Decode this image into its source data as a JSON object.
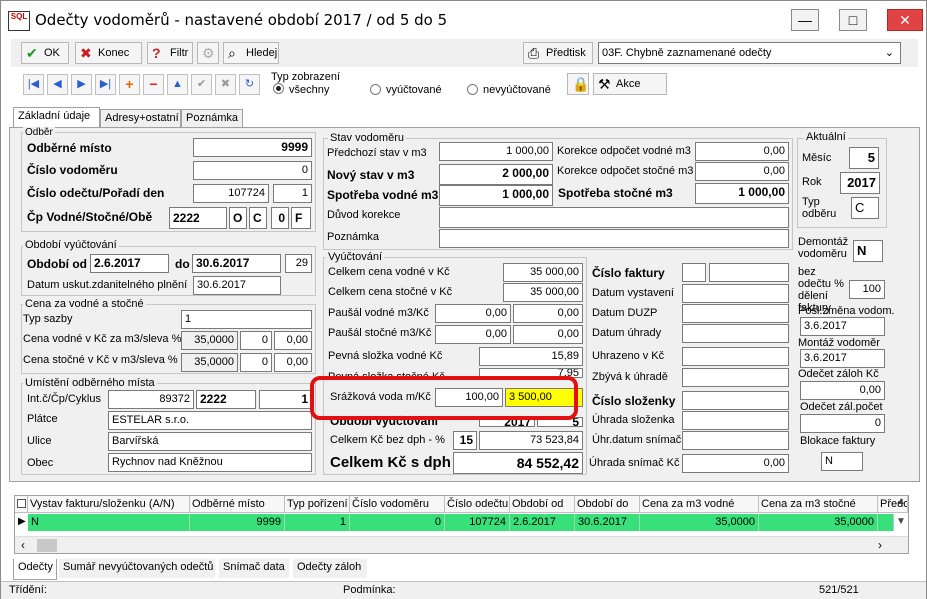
{
  "window": {
    "title": "Odečty vodoměrů - nastavené období 2017 / od 5 do 5",
    "logo": "SQL"
  },
  "toolbar1": {
    "ok": "OK",
    "konec": "Konec",
    "filtr": "Filtr",
    "hledej": "Hledej",
    "predtisk": "Předtisk",
    "report": "03F. Chybně zaznamenané odečty"
  },
  "toolbar2": {
    "view_label": "Typ zobrazení",
    "r_all": "všechny",
    "r_billed": "vyúčtované",
    "r_unbilled": "nevyúčtované",
    "akce": "Akce"
  },
  "tabs": [
    "Základní údaje",
    "Adresy+ostatní",
    "Poznámka"
  ],
  "left": {
    "odberatel": "Odběr",
    "odberne_misto_lbl": "Odběrné místo",
    "odberne_misto": "9999",
    "cislo_vodomeru_lbl": "Číslo vodoměru",
    "cislo_vodomeru": "0",
    "cislo_odectu_lbl": "Číslo odečtu/Pořadí den",
    "cislo_odectu": "107724",
    "poradi": "1",
    "cp_lbl": "Čp  Vodné/Stočné/Obě",
    "cp": "2222",
    "o": "O",
    "c": "C",
    "zero": "0",
    "f": "F",
    "obdobi_grp": "Období vyúčtování",
    "obdobi_od_lbl": "Období od",
    "obdobi_od": "2.6.2017",
    "do_lbl": "do",
    "obdobi_do": "30.6.2017",
    "dni": "29",
    "datum_uskut_lbl": "Datum uskut.zdanitelného plnění",
    "datum_uskut": "30.6.2017",
    "cena_grp": "Cena za vodné a stočné",
    "typ_sazby_lbl": "Typ sazby",
    "typ_sazby": "1",
    "cena_vodne_lbl": "Cena vodné v Kč za m3/sleva %",
    "cena_vodne": "35,0000",
    "cv_a": "0",
    "cv_b": "0,00",
    "cena_stocne_lbl": "Cena stočné v Kč v m3/sleva %",
    "cena_stocne": "35,0000",
    "cs_a": "0",
    "cs_b": "0,00",
    "umisteni_grp": "Umístění odběrného místa",
    "intc_lbl": "Int.č/Čp/Cyklus",
    "intc": "89372",
    "intc_cp": "2222",
    "cyklus": "1",
    "platce_lbl": "Plátce",
    "platce": "ESTELAR s.r.o.",
    "ulice_lbl": "Ulice",
    "ulice": "Barvířská",
    "obec_lbl": "Obec",
    "obec": "Rychnov nad Kněžnou"
  },
  "stav": {
    "grp": "Stav vodoměru",
    "predchozi_lbl": "Předchozí stav v m3",
    "predchozi": "1 000,00",
    "korekce_vodne_lbl": "Korekce odpočet vodné m3",
    "korekce_vodne": "0,00",
    "novy_lbl": "Nový stav v m3",
    "novy": "2 000,00",
    "korekce_stocne_lbl": "Korekce odpočet stočné m3",
    "korekce_stocne": "0,00",
    "spotreba_vodne_lbl": "Spotřeba vodné m3",
    "spotreba_vodne": "1 000,00",
    "spotreba_stocne_lbl": "Spotřeba stočné m3",
    "spotreba_stocne": "1 000,00",
    "duvod_lbl": "Důvod korekce",
    "poznamka_lbl": "Poznámka"
  },
  "vyuct": {
    "grp": "Vyúčtování",
    "celkem_vodne_lbl": "Celkem cena vodné v Kč",
    "celkem_vodne": "35 000,00",
    "celkem_stocne_lbl": "Celkem cena stočné v Kč",
    "celkem_stocne": "35 000,00",
    "pausal_vodne_lbl": "Paušál vodné m3/Kč",
    "pausal_vodne_a": "0,00",
    "pausal_vodne_b": "0,00",
    "pausal_stocne_lbl": "Paušál stočné m3/Kč",
    "pausal_stocne_a": "0,00",
    "pausal_stocne_b": "0,00",
    "pevna_vodne_lbl": "Pevná složka vodné Kč",
    "pevna_vodne": "15,89",
    "pevna_stocne_lbl": "Pevná složka stočné Kč",
    "pevna_stocne": "7,95",
    "srazkova_lbl": "Srážková voda m/Kč",
    "srazkova_a": "100,00",
    "srazkova_b": "3 500,00",
    "obdobi_lbl": "Období vyúčtování",
    "obdobi_rok": "2017",
    "obdobi_mes": "5",
    "bez_dph_lbl": "Celkem Kč bez dph  - %",
    "dph": "15",
    "bez_dph": "73 523,84",
    "s_dph_lbl": "Celkem Kč s dph",
    "s_dph": "84 552,42"
  },
  "faktura": {
    "cislo_faktury_lbl": "Číslo faktury",
    "datum_vystaveni_lbl": "Datum vystavení",
    "datum_duzp_lbl": "Datum DUZP",
    "datum_uhrady_lbl": "Datum úhrady",
    "uhrazeno_lbl": "Uhrazeno v Kč",
    "zbyva_lbl": "Zbývá k úhradě",
    "cislo_slozenky_lbl": "Číslo složenky",
    "uhrada_slozenka_lbl": "Úhrada složenka",
    "uhr_datum_lbl": "Úhr.datum snímač",
    "uhrada_snimac_lbl": "Úhrada snímač Kč",
    "uhrada_snimac": "0,00"
  },
  "aktualni": {
    "grp": "Aktuální",
    "mesic_lbl": "Měsíc",
    "mesic": "5",
    "rok_lbl": "Rok",
    "rok": "2017",
    "typ_lbl": "Typ odběru",
    "typ": "C",
    "demontaz_lbl": "Demontáž vodoměru",
    "demontaz": "N",
    "bez_odectu_lbl": "bez odečtu % dělení faktury",
    "bez_odectu": "100",
    "posl_zmena_lbl": "Posl.změna vodom.",
    "posl_zmena": "3.6.2017",
    "montaz_lbl": "Montáž vodoměr",
    "montaz": "3.6.2017",
    "odecet_zaloh_lbl": "Odečet záloh Kč",
    "odecet_zaloh": "0,00",
    "odecet_zal_pocet_lbl": "Odečet zál.počet",
    "odecet_zal_pocet": "0",
    "blokace_lbl": "Blokace faktury",
    "blokace": "N"
  },
  "grid": {
    "headers": [
      "Vystav fakturu/složenku (A/N)",
      "Odběrné místo",
      "Typ pořízení",
      "Číslo vodoměru",
      "Číslo odečtu",
      "Období od",
      "Období do",
      "Cena za m3 vodné",
      "Cena za m3 stočné",
      "Předo"
    ],
    "row": [
      "N",
      "9999",
      "1",
      "0",
      "107724",
      "2.6.2017",
      "30.6.2017",
      "35,0000",
      "35,0000",
      ""
    ]
  },
  "bottom_tabs": [
    "Odečty",
    "Sumář nevyúčtovaných odečtů",
    "Snímač data",
    "Odečty záloh"
  ],
  "status": {
    "trideni": "Třídění:",
    "podminka": "Podmínka:",
    "count": "521/521"
  }
}
